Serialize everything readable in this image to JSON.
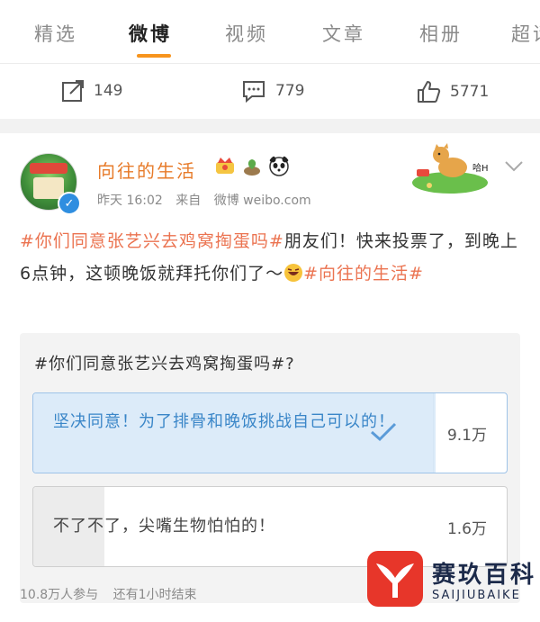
{
  "tabs": [
    "精选",
    "微博",
    "视频",
    "文章",
    "相册",
    "超话"
  ],
  "active_tab_index": 1,
  "actions": {
    "repost": {
      "icon": "share-icon",
      "count": "149"
    },
    "comment": {
      "icon": "comment-icon",
      "count": "779"
    },
    "like": {
      "icon": "thumbs-up-icon",
      "count": "5771"
    }
  },
  "post": {
    "username": "向往的生活",
    "time": "昨天 16:02",
    "source_prefix": "来自",
    "source": "微博 weibo.com",
    "text_hashtag_1": "#你们同意张艺兴去鸡窝掏蛋吗#",
    "text_body": "朋友们！快来投票了，到晚上6点钟，这顿晚饭就拜托你们了～",
    "text_hashtag_2": "#向往的生活#"
  },
  "poll": {
    "question": "#你们同意张艺兴去鸡窝掏蛋吗#?",
    "options": [
      {
        "label": "坚决同意！为了排骨和晚饭挑战自己可以的！",
        "count": "9.1万",
        "selected": true,
        "share": 0.85
      },
      {
        "label": "不了不了，尖嘴生物怕怕的！",
        "count": "1.6万",
        "selected": false,
        "share": 0.15
      }
    ],
    "participants": "10.8万人参与",
    "time_left": "还有1小时结束"
  },
  "watermark": {
    "title": "赛玖百科",
    "subtitle": "SAIJIUBAIKE"
  },
  "colors": {
    "accent": "#f7941d",
    "username": "#e77b2a",
    "hashtag": "#eb7350",
    "selected_fill": "#dcebf9",
    "selected_text": "#3a86c8"
  }
}
